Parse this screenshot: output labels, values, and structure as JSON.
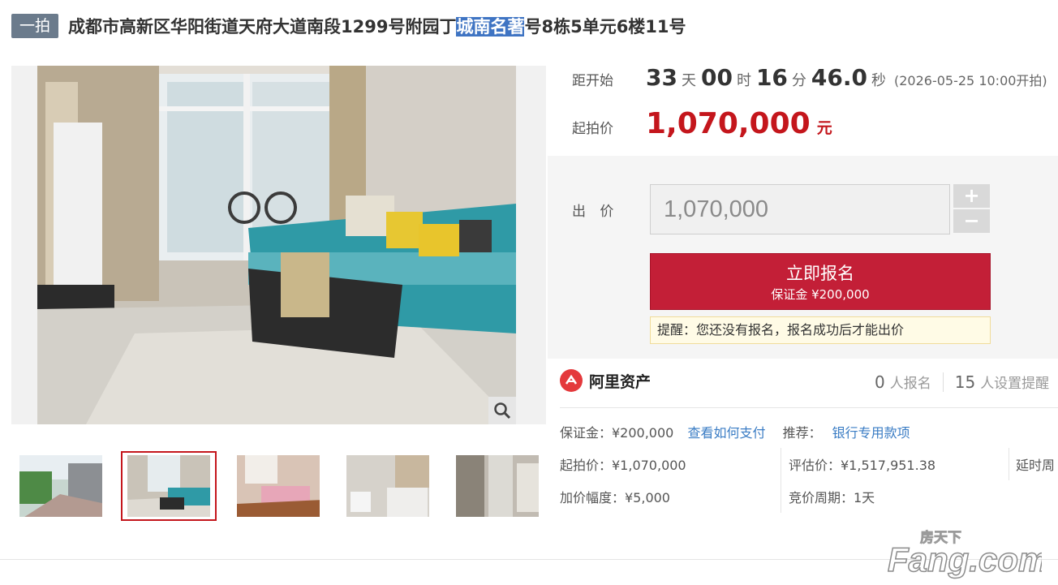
{
  "header": {
    "badge": "一拍",
    "title_before": "成都市高新区华阳街道天府大道南段1299号附园丁",
    "title_highlight": "城南名著",
    "title_after": "号8栋5单元6楼11号"
  },
  "countdown": {
    "label": "距开始",
    "days": "33",
    "days_unit": "天",
    "hours": "00",
    "hours_unit": "时",
    "minutes": "16",
    "minutes_unit": "分",
    "seconds": "46.0",
    "seconds_unit": "秒",
    "start_time": "(2026-05-25 10:00开拍)"
  },
  "price": {
    "label": "起拍价",
    "value": "1,070,000",
    "unit": "元"
  },
  "bid": {
    "label": "出 价",
    "input_value": "1,070,000",
    "plus": "+",
    "minus": "−",
    "signup_label": "立即报名",
    "deposit_label": "保证金 ¥200,000",
    "tip": "提醒：您还没有报名，报名成功后才能出价"
  },
  "platform": {
    "name": "阿里资产",
    "signups_count": "0",
    "signups_label": "人报名",
    "reminders_count": "15",
    "reminders_label": "人设置提醒"
  },
  "details": {
    "deposit": "保证金：¥200,000",
    "how_to_pay": "查看如何支付",
    "recommend_label": "推荐：",
    "recommend_link": "银行专用款项",
    "start_price": "起拍价：¥1,070,000",
    "appraisal": "评估价：¥1,517,951.38",
    "delay": "延时周",
    "increment": "加价幅度：¥5,000",
    "cycle": "竞价周期：1天"
  },
  "watermark": {
    "text1": "房天下",
    "text2": "Fang.com"
  },
  "colors": {
    "accent_red": "#c4161c",
    "button_red": "#c31f37",
    "link_blue": "#3a7cc4",
    "highlight_blue": "#3f74c3"
  }
}
